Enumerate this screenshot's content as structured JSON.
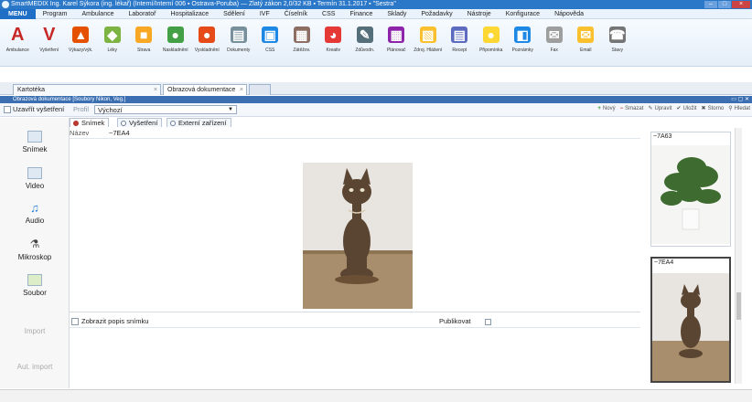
{
  "window": {
    "title": "SmartMEDIX   Ing. Karel Sýkora (ing. lékař) (Interní/Interní 006 ▪ Ostrava-Poruba) — Zlatý zákon 2,0/32 KB ▪ Termín 31.1.2017 ▪ \"Sestra\""
  },
  "menubar": {
    "items": [
      "MENU",
      "Program",
      "Ambulance",
      "Laboratoř",
      "Hospitalizace",
      "Sdělení",
      "IVF",
      "Číselník",
      "CSS",
      "Finance",
      "Sklady",
      "Požadavky",
      "Nástroje",
      "Konfigurace",
      "Nápověda"
    ]
  },
  "ribbon": {
    "buttons": [
      {
        "label": "Ambulance",
        "icon": "A",
        "color": "#c62828"
      },
      {
        "label": "Vyšetření",
        "icon": "V",
        "color": "#c62828"
      },
      {
        "label": "Výkazy/výk.",
        "icon": "▲",
        "color": "#e65100"
      },
      {
        "label": "Léky",
        "icon": "◆",
        "color": "#7cb342"
      },
      {
        "label": "Strava",
        "icon": "■",
        "color": "#f9a825"
      },
      {
        "label": "Naskladnění",
        "icon": "●",
        "color": "#43a047"
      },
      {
        "label": "Vyskladnění",
        "icon": "●",
        "color": "#e64a19"
      },
      {
        "label": "Dokumenty",
        "icon": "▤",
        "color": "#78909c"
      },
      {
        "label": "CSS",
        "icon": "▣",
        "color": "#1e88e5"
      },
      {
        "label": "Zátěžov.",
        "icon": "▦",
        "color": "#8d6e63"
      },
      {
        "label": "Kreativ",
        "icon": "◕",
        "color": "#e53935"
      },
      {
        "label": "Zdůvodn.",
        "icon": "✎",
        "color": "#546e7a"
      },
      {
        "label": "Plánovač",
        "icon": "▦",
        "color": "#8e24aa"
      },
      {
        "label": "Zdroj. Hlášení",
        "icon": "▧",
        "color": "#fbc02d"
      },
      {
        "label": "Recept",
        "icon": "▤",
        "color": "#5c6bc0"
      },
      {
        "label": "Připomínka",
        "icon": "●",
        "color": "#fdd835"
      },
      {
        "label": "Poznámky",
        "icon": "◧",
        "color": "#1e88e5"
      },
      {
        "label": "Fax",
        "icon": "✉",
        "color": "#9e9e9e"
      },
      {
        "label": "Email",
        "icon": "✉",
        "color": "#fbc02d"
      },
      {
        "label": "Stavy",
        "icon": "☎",
        "color": "#757575"
      }
    ]
  },
  "tabs": [
    {
      "label": "Kartotéka"
    },
    {
      "label": "Obrazová dokumentace"
    }
  ],
  "document": {
    "title": "Obrazová dokumentace [Soubory Nikon, Veg.]"
  },
  "toolbar": {
    "filter_label": "Uzavřít vyšetření",
    "profile_label": "Profil",
    "profile_value": "Výchozí",
    "actions": [
      {
        "label": "Nový",
        "icon": "+",
        "tone": "g"
      },
      {
        "label": "Smazat",
        "icon": "−",
        "tone": "r"
      },
      {
        "label": "Upravit",
        "icon": "✎",
        "tone": ""
      },
      {
        "label": "Uložit",
        "icon": "✔",
        "tone": ""
      },
      {
        "label": "Storno",
        "icon": "✖",
        "tone": ""
      },
      {
        "label": "Hledat",
        "icon": "⚲",
        "tone": ""
      }
    ]
  },
  "left_panel": {
    "items": [
      {
        "label": "Snímek",
        "icon": "picture-icon",
        "enabled": true
      },
      {
        "label": "Video",
        "icon": "video-icon",
        "enabled": true
      },
      {
        "label": "Audio",
        "icon": "audio-icon",
        "enabled": true
      },
      {
        "label": "Mikroskop",
        "icon": "microscope-icon",
        "enabled": true
      },
      {
        "label": "Soubor",
        "icon": "file-icon",
        "enabled": true
      },
      {
        "label": "Import",
        "icon": "",
        "enabled": false
      },
      {
        "label": "Aut. import",
        "icon": "",
        "enabled": false
      }
    ]
  },
  "content_tabs": [
    {
      "label": "Snímek",
      "active": true
    },
    {
      "label": "Vyšetření",
      "active": false
    },
    {
      "label": "Externí zařízení",
      "active": false
    }
  ],
  "detail": {
    "name_label": "Název",
    "name_value": "~7EA4",
    "desc_label": "Zobrazit popis snímku",
    "publish_label": "Publikovat"
  },
  "thumbnails": [
    {
      "caption": "~7A63",
      "subject": "plant"
    },
    {
      "caption": "~7EA4",
      "subject": "cat-statue",
      "selected": true
    }
  ]
}
